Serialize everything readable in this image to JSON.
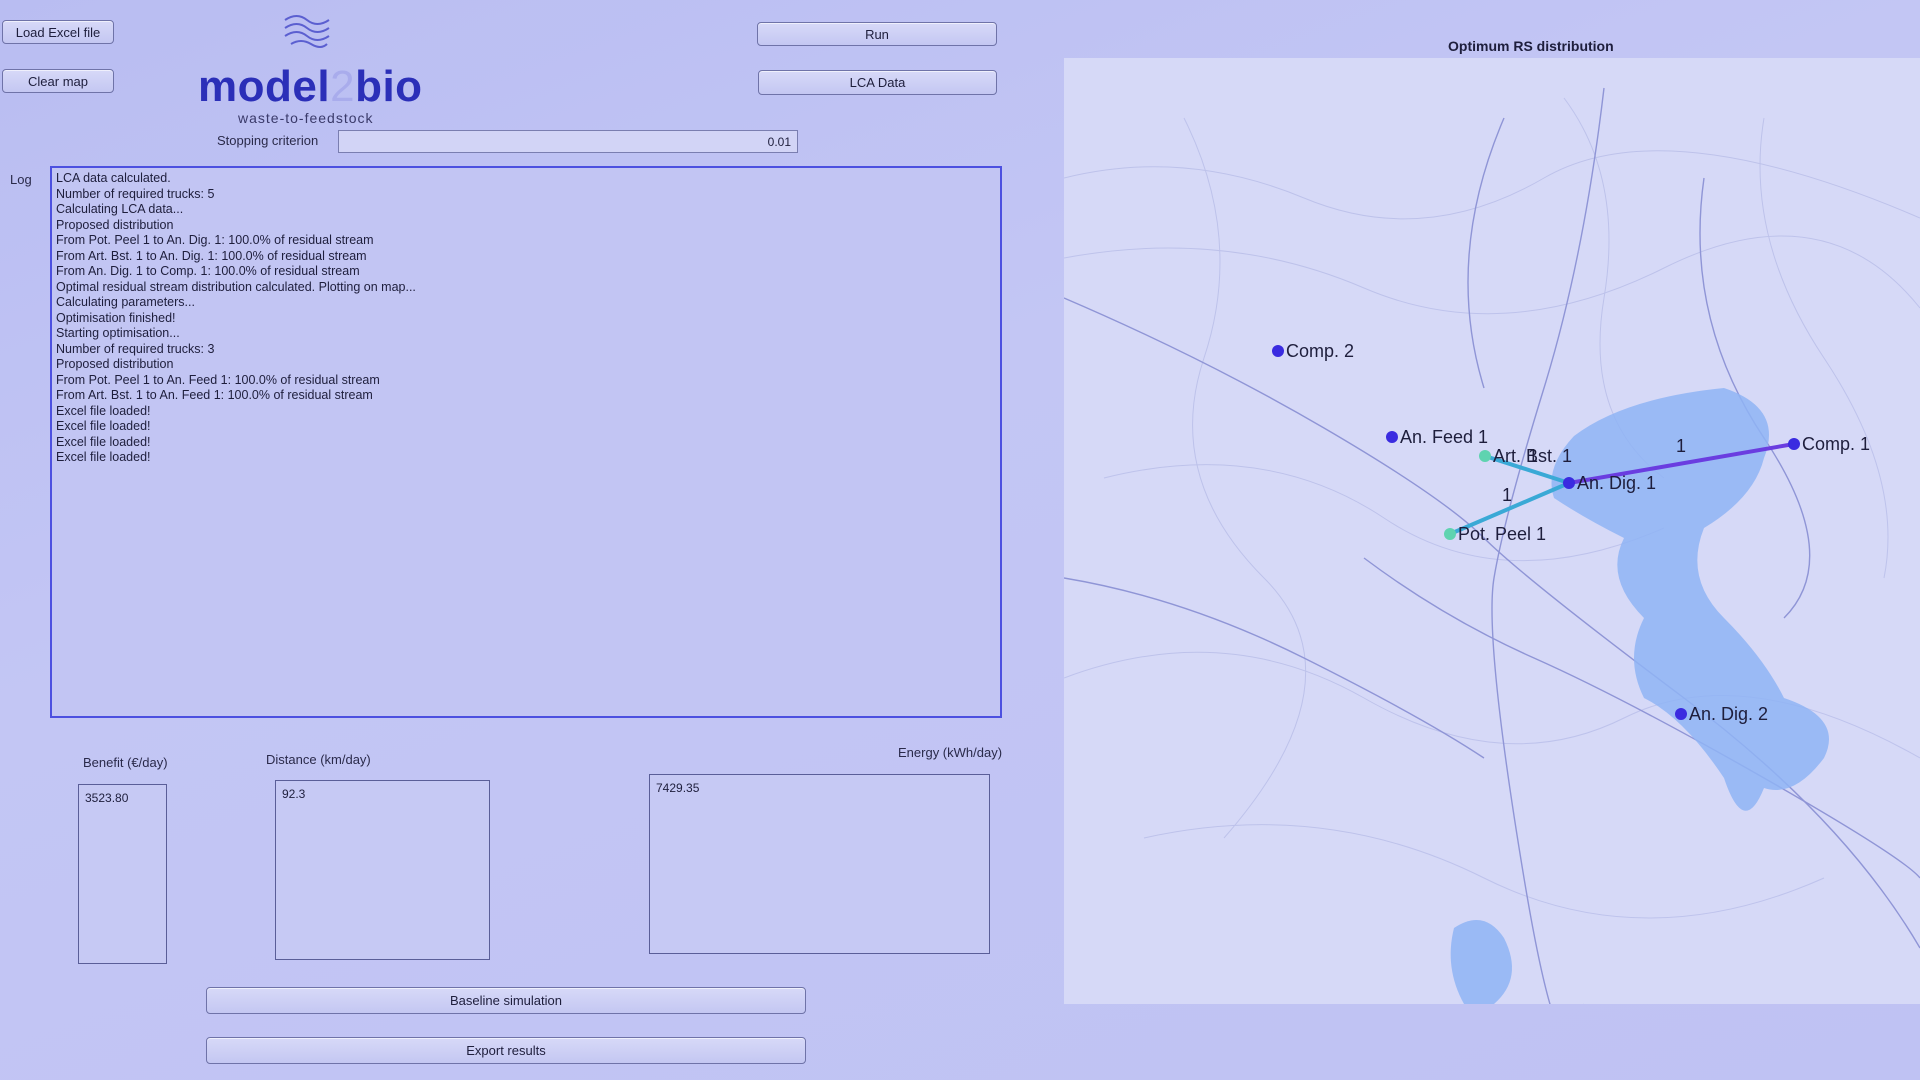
{
  "toolbar": {
    "load_excel": "Load Excel file",
    "clear_map": "Clear map",
    "run": "Run",
    "lca_data": "LCA Data"
  },
  "logo": {
    "text_left": "model",
    "text_mid": "2",
    "text_right": "bio",
    "tagline": "waste-to-feedstock"
  },
  "stopping": {
    "label": "Stopping criterion",
    "value": "0.01"
  },
  "log": {
    "label": "Log",
    "lines": [
      "LCA data calculated.",
      "Number of required trucks: 5",
      "Calculating LCA data...",
      "Proposed distribution",
      "From Pot. Peel 1 to An. Dig. 1: 100.0% of residual stream",
      "From Art. Bst. 1 to An. Dig. 1: 100.0% of residual stream",
      "From An. Dig. 1 to Comp. 1: 100.0% of residual stream",
      "Optimal residual stream distribution calculated. Plotting on map...",
      "Calculating parameters...",
      "Optimisation finished!",
      "Starting optimisation...",
      "Number of required trucks: 3",
      "Proposed distribution",
      "From Pot. Peel 1 to An. Feed 1: 100.0% of residual stream",
      "From Art. Bst. 1 to An. Feed 1: 100.0% of residual stream",
      "Excel file loaded!",
      "Excel file loaded!",
      "Excel file loaded!",
      "Excel file loaded!"
    ]
  },
  "metrics": {
    "benefit_label": "Benefit (€/day)",
    "benefit_value": "3523.80",
    "distance_label": "Distance (km/day)",
    "distance_value": "92.3",
    "energy_label": "Energy (kWh/day)",
    "energy_value": "7429.35"
  },
  "actions": {
    "baseline": "Baseline simulation",
    "export": "Export results"
  },
  "map": {
    "title": "Optimum RS distribution",
    "nodes": {
      "comp2": "Comp. 2",
      "anfeed1": "An. Feed 1",
      "artbst1": "Art. Bst. 1",
      "andig1": "An. Dig. 1",
      "comp1": "Comp. 1",
      "potpeel1": "Pot. Peel 1",
      "andig2": "An. Dig. 2"
    },
    "edge_labels": {
      "peel_to_dig": "1",
      "bst_to_dig": "1",
      "dig_to_comp": "1"
    },
    "colors": {
      "consumer": "#3a2be0",
      "producer": "#5fd3b0",
      "route_in": "#3aa9d6",
      "route_out": "#6a3de0",
      "water": "#8fb4f4"
    }
  }
}
